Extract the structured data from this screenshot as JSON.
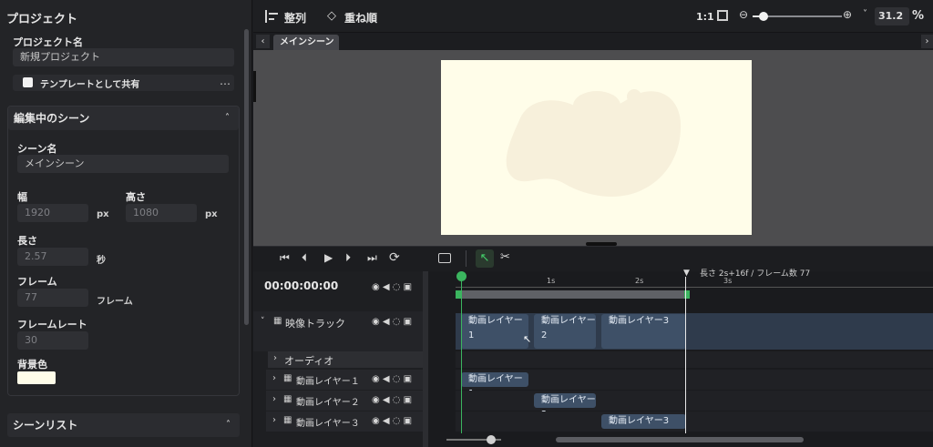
{
  "project": {
    "title": "プロジェクト",
    "name_label": "プロジェクト名",
    "name_value": "新規プロジェクト",
    "template_share_label": "テンプレートとして共有",
    "more_icon": "…"
  },
  "scene_edit": {
    "header": "編集中のシーン",
    "scene_name_label": "シーン名",
    "scene_name_value": "メインシーン",
    "width_label": "幅",
    "width_value": "1920",
    "width_unit": "px",
    "height_label": "高さ",
    "height_value": "1080",
    "height_unit": "px",
    "length_label": "長さ",
    "length_value": "2.57",
    "length_unit": "秒",
    "frames_label": "フレーム",
    "frames_value": "77",
    "frames_unit": "フレーム",
    "framerate_label": "フレームレート",
    "framerate_value": "30",
    "bgcolor_label": "背景色",
    "bgcolor_value": "#fffde9"
  },
  "scene_list": {
    "header": "シーンリスト"
  },
  "toolbar": {
    "align_label": "整列",
    "order_label": "重ね順",
    "ratio_label": "1:1",
    "zoom_value": "31.2",
    "zoom_unit": "%",
    "zoom_level": 0.12
  },
  "preview": {
    "tab_label": "メインシーン",
    "canvas_color": "#fffde9",
    "blob_color": "#f7f0db"
  },
  "timeline": {
    "timecode": "00:00:00:00",
    "length_info": "長さ 2s+16f / フレーム数 77",
    "ruler": [
      "1s",
      "2s",
      "3s"
    ],
    "video_track_label": "映像トラック",
    "audio_label": "オーディオ",
    "layers": [
      "動画レイヤー１",
      "動画レイヤー２",
      "動画レイヤー３"
    ],
    "clips": [
      "動画レイヤー1",
      "動画レイヤー2",
      "動画レイヤー3"
    ],
    "playhead_color": "#3bb55f",
    "clip_color": "#3e5067"
  }
}
